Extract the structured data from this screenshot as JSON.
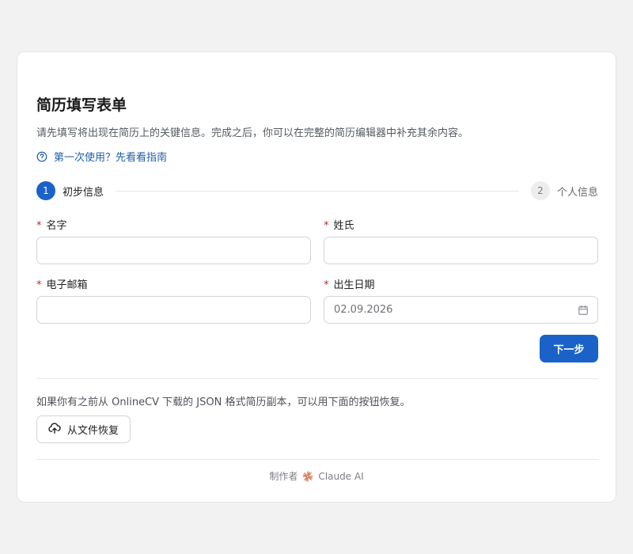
{
  "form": {
    "title": "简历填写表单",
    "subtitle": "请先填写将出现在简历上的关键信息。完成之后，你可以在完整的简历编辑器中补充其余内容。",
    "guide_link": "第一次使用？先看看指南"
  },
  "steps": [
    {
      "number": "1",
      "label": "初步信息",
      "active": true
    },
    {
      "number": "2",
      "label": "个人信息",
      "active": false
    }
  ],
  "fields": {
    "first_name": {
      "label": "名字",
      "required_mark": "*",
      "value": ""
    },
    "last_name": {
      "label": "姓氏",
      "required_mark": "*",
      "value": ""
    },
    "email": {
      "label": "电子邮箱",
      "required_mark": "*",
      "value": ""
    },
    "birth_date": {
      "label": "出生日期",
      "required_mark": "*",
      "value": "02.09.2026"
    }
  },
  "buttons": {
    "next": "下一步",
    "restore": "从文件恢复"
  },
  "restore": {
    "text": "如果你有之前从 OnlineCV 下载的 JSON 格式简历副本，可以用下面的按钮恢复。"
  },
  "footer": {
    "prefix": "制作者",
    "author": "Claude AI",
    "icon": "claude-spark-icon"
  },
  "colors": {
    "accent": "#1a62c7",
    "link": "#1f5fa9",
    "required": "#c0292b",
    "brand_spark": "#d97757"
  }
}
